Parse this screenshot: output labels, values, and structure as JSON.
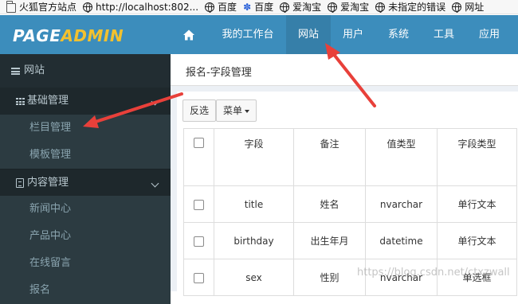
{
  "bookmarks": [
    {
      "icon": "folder-icon",
      "label": "火狐官方站点"
    },
    {
      "icon": "globe-icon",
      "label": "http://localhost:802..."
    },
    {
      "icon": "globe-icon",
      "label": "百度"
    },
    {
      "icon": "paw-icon",
      "label": "百度"
    },
    {
      "icon": "globe-icon",
      "label": "爱淘宝"
    },
    {
      "icon": "globe-icon",
      "label": "爱淘宝"
    },
    {
      "icon": "globe-icon",
      "label": "未指定的错误"
    },
    {
      "icon": "globe-icon",
      "label": "网址"
    }
  ],
  "brand": {
    "part1": "PAGE",
    "part2": "ADMIN"
  },
  "topnav": {
    "home_icon": "home-icon",
    "items": [
      "我的工作台",
      "网站",
      "用户",
      "系统",
      "工具",
      "应用"
    ],
    "active": "网站"
  },
  "sidebar": {
    "header": "网站",
    "groups": [
      {
        "label": "基础管理",
        "icon": "grid-icon",
        "items": [
          "栏目管理",
          "模板管理"
        ]
      },
      {
        "label": "内容管理",
        "icon": "document-icon",
        "items": [
          "新闻中心",
          "产品中心",
          "在线留言",
          "报名"
        ]
      }
    ]
  },
  "breadcrumb": "报名-字段管理",
  "toolbar": {
    "invert_label": "反选",
    "menu_label": "菜单"
  },
  "table": {
    "columns": [
      "字段",
      "备注",
      "值类型",
      "字段类型"
    ],
    "rows": [
      [
        "title",
        "姓名",
        "nvarchar",
        "单行文本"
      ],
      [
        "birthday",
        "出生年月",
        "datetime",
        "单行文本"
      ],
      [
        "sex",
        "性别",
        "nvarchar",
        "单选框"
      ]
    ]
  },
  "watermark": "https://blog.csdn.net/ctxzwall",
  "colors": {
    "nav_bg": "#3c8dbc",
    "nav_active": "#367fa9",
    "brand_accent": "#f2c12e",
    "sidebar_bg": "#222d32",
    "arrow": "#e8403a"
  }
}
